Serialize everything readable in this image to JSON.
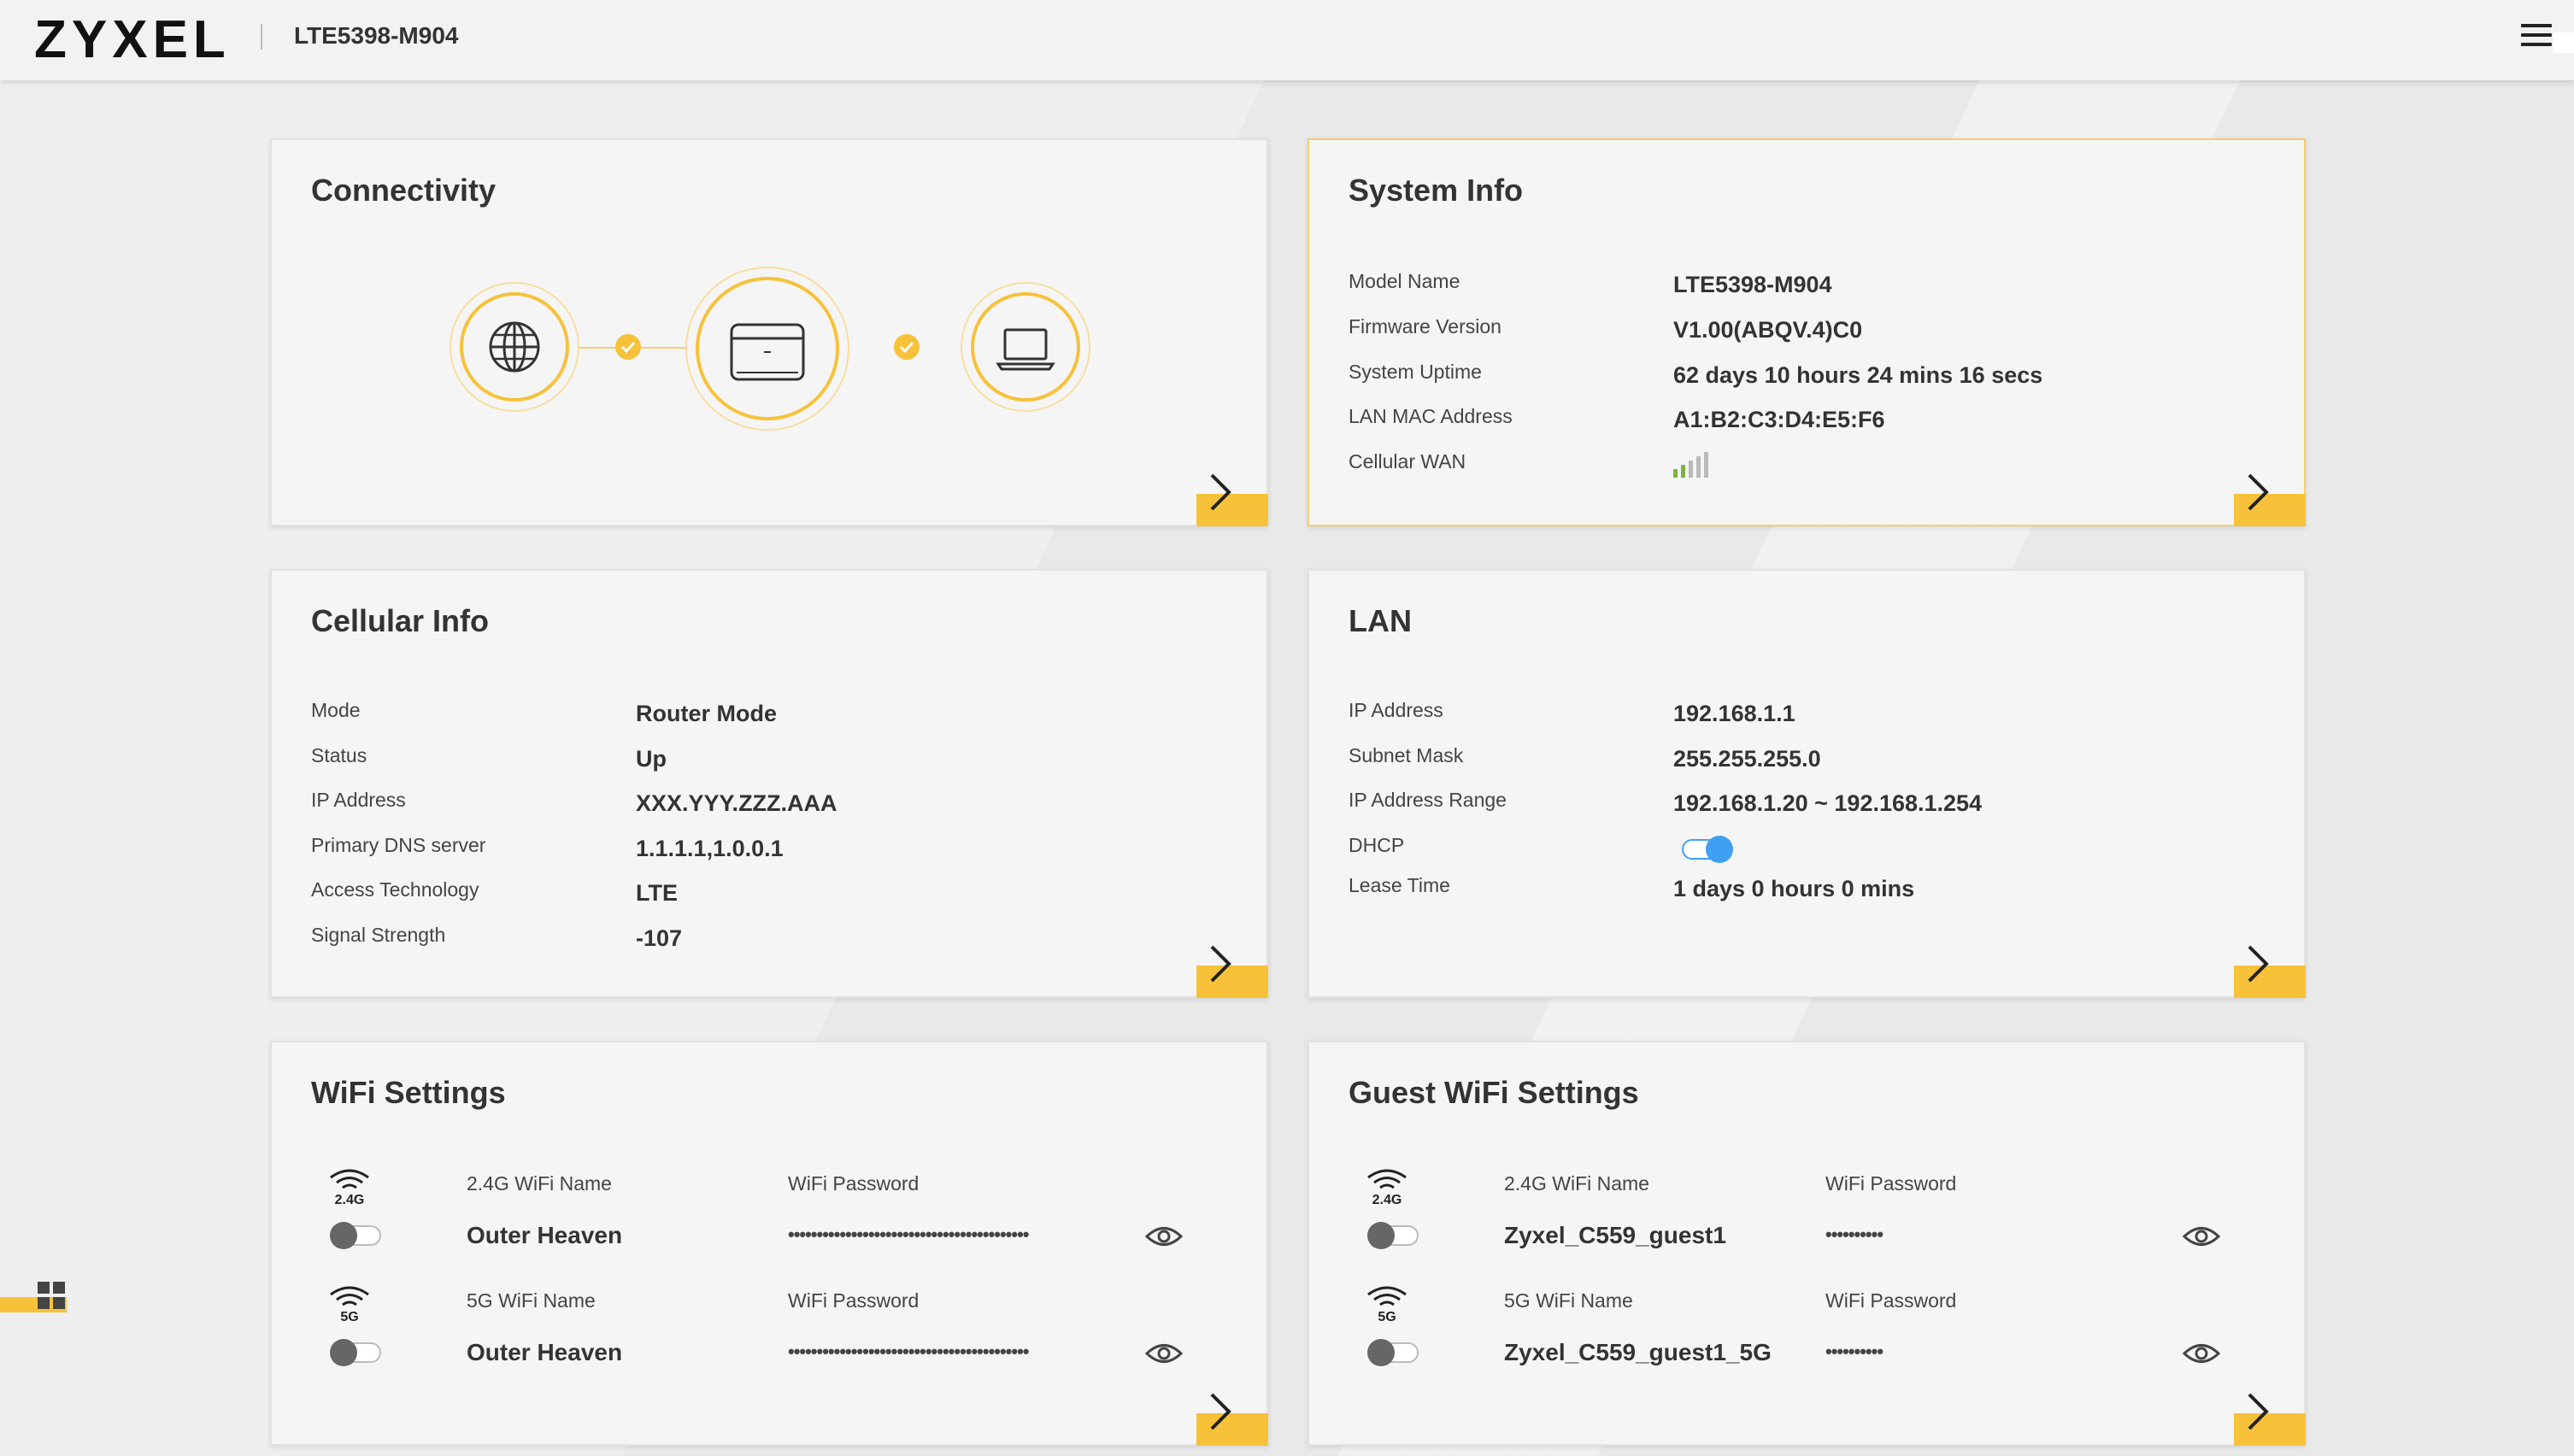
{
  "header": {
    "brand": "ZYXEL",
    "model": "LTE5398-M904"
  },
  "colors": {
    "accent": "#f7c23a",
    "toggle_on": "#3f9ff2",
    "signal_active": "#7cb342"
  },
  "connectivity": {
    "title": "Connectivity",
    "nodes": [
      "globe-icon",
      "router-icon",
      "laptop-icon"
    ],
    "links": [
      "connected",
      "connected"
    ]
  },
  "system_info": {
    "title": "System Info",
    "rows": [
      {
        "label": "Model Name",
        "value": "LTE5398-M904"
      },
      {
        "label": "Firmware Version",
        "value": "V1.00(ABQV.4)C0"
      },
      {
        "label": "System Uptime",
        "value": "62 days 10 hours 24 mins 16 secs"
      },
      {
        "label": "LAN MAC Address",
        "value": "A1:B2:C3:D4:E5:F6"
      },
      {
        "label": "Cellular WAN",
        "value": ""
      }
    ],
    "signal_bars_active": 2,
    "signal_bars_total": 5
  },
  "cellular_info": {
    "title": "Cellular Info",
    "rows": [
      {
        "label": "Mode",
        "value": "Router Mode"
      },
      {
        "label": "Status",
        "value": "Up"
      },
      {
        "label": "IP Address",
        "value": "XXX.YYY.ZZZ.AAA"
      },
      {
        "label": "Primary DNS server",
        "value": "1.1.1.1,1.0.0.1"
      },
      {
        "label": "Access Technology",
        "value": "LTE"
      },
      {
        "label": "Signal Strength",
        "value": "-107"
      }
    ]
  },
  "lan": {
    "title": "LAN",
    "rows": [
      {
        "label": "IP Address",
        "value": "192.168.1.1"
      },
      {
        "label": "Subnet Mask",
        "value": "255.255.255.0"
      },
      {
        "label": "IP Address Range",
        "value": "192.168.1.20 ~ 192.168.1.254"
      },
      {
        "label": "DHCP",
        "value": ""
      },
      {
        "label": "Lease Time",
        "value": "1 days 0 hours 0 mins"
      }
    ],
    "dhcp_enabled": true
  },
  "wifi": {
    "title": "WiFi Settings",
    "bands": [
      {
        "band": "2.4G",
        "name_label": "2.4G WiFi Name",
        "name": "Outer Heaven",
        "pass_label": "WiFi Password",
        "password": "••••••••••••••••••••••••••••••••••••••••••",
        "enabled": false
      },
      {
        "band": "5G",
        "name_label": "5G WiFi Name",
        "name": "Outer Heaven",
        "pass_label": "WiFi Password",
        "password": "••••••••••••••••••••••••••••••••••••••••••",
        "enabled": false
      }
    ]
  },
  "guest_wifi": {
    "title": "Guest WiFi Settings",
    "bands": [
      {
        "band": "2.4G",
        "name_label": "2.4G WiFi Name",
        "name": "Zyxel_C559_guest1",
        "pass_label": "WiFi Password",
        "password": "••••••••••",
        "enabled": false
      },
      {
        "band": "5G",
        "name_label": "5G WiFi Name",
        "name": "Zyxel_C559_guest1_5G",
        "pass_label": "WiFi Password",
        "password": "••••••••••",
        "enabled": false
      }
    ]
  }
}
